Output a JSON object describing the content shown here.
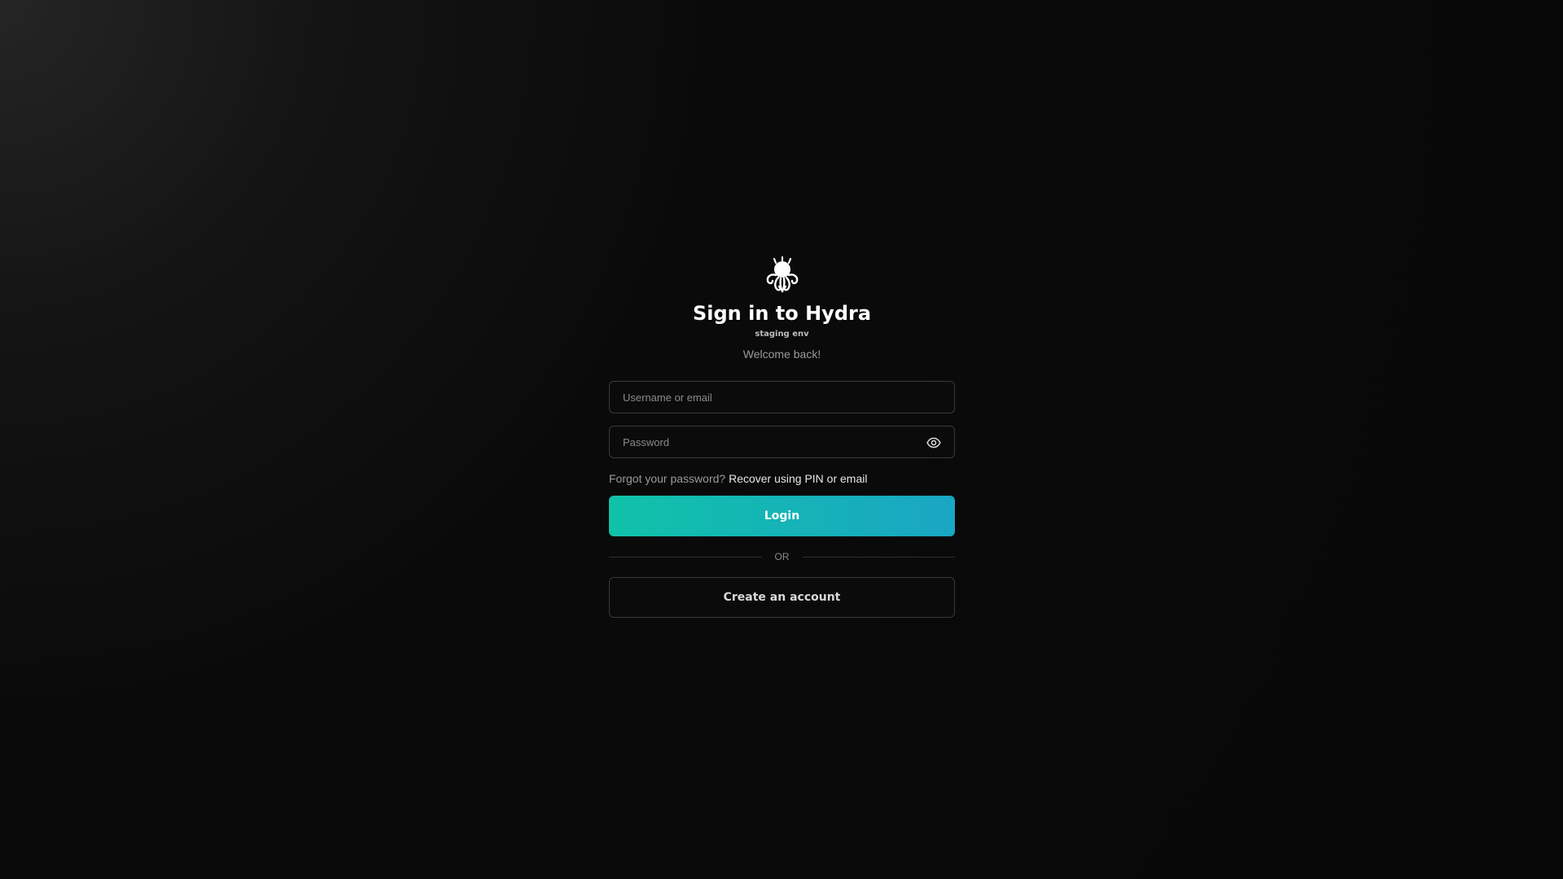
{
  "app": {
    "logo_icon": "octopus-logo-icon"
  },
  "header": {
    "title": "Sign in to Hydra",
    "env_label": "staging env",
    "welcome": "Welcome back!"
  },
  "form": {
    "username_placeholder": "Username or email",
    "username_value": "",
    "password_placeholder": "Password",
    "password_value": "",
    "password_toggle_icon": "eye-icon",
    "forgot_text": "Forgot your password?",
    "recover_link": "Recover using PIN or email",
    "login_label": "Login",
    "or_label": "OR",
    "create_account_label": "Create an account"
  },
  "colors": {
    "accent_start": "#10c2a8",
    "accent_end": "#1aa6c4",
    "background": "#080808"
  }
}
